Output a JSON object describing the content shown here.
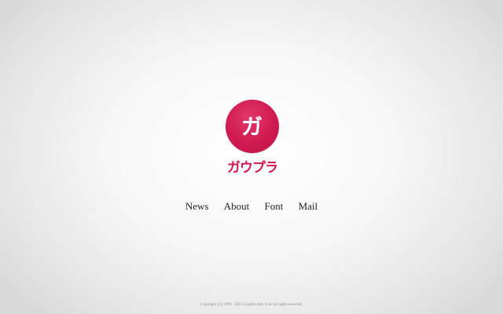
{
  "logo": {
    "glyph": "ガ",
    "wordmark": "ガウプラ",
    "color": "#cf1a4f"
  },
  "nav": {
    "items": [
      {
        "label": "News"
      },
      {
        "label": "About"
      },
      {
        "label": "Font"
      },
      {
        "label": "Mail"
      }
    ]
  },
  "footer": {
    "copyright": "Copyright (C) 1999 - 2011 Graphic Arts Unit All rights reserved."
  }
}
